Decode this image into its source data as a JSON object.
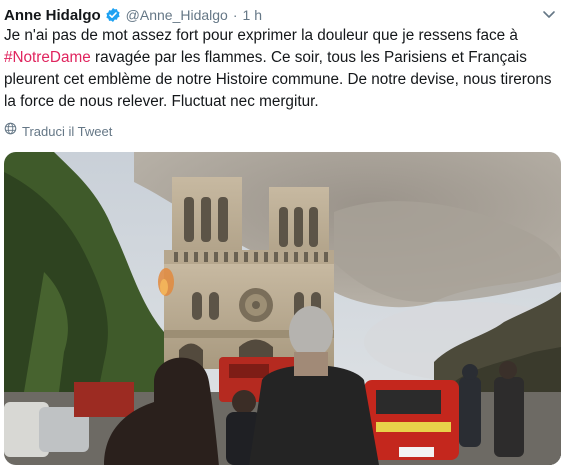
{
  "tweet": {
    "author_name": "Anne Hidalgo",
    "handle": "@Anne_Hidalgo",
    "separator": "·",
    "time": "1 h",
    "text_part1": "Je n'ai pas de mot assez fort pour exprimer la douleur que je ressens face à",
    "hashtag": "#NotreDame",
    "text_part2": " ravagée par les flammes. Ce soir, tous les Parisiens et Français pleurent cet emblème de notre Histoire commune. De notre devise, nous tirerons la force de nous relever. Fluctuat nec mergitur.",
    "translate_label": "Traduci il Tweet"
  },
  "icons": {
    "verified": "verified-badge-icon",
    "caret": "chevron-down-icon",
    "translate": "globe-icon"
  },
  "colors": {
    "accent": "#1da1f2",
    "hashtag": "#e0245e",
    "secondary_text": "#657786",
    "primary_text": "#14171a"
  }
}
